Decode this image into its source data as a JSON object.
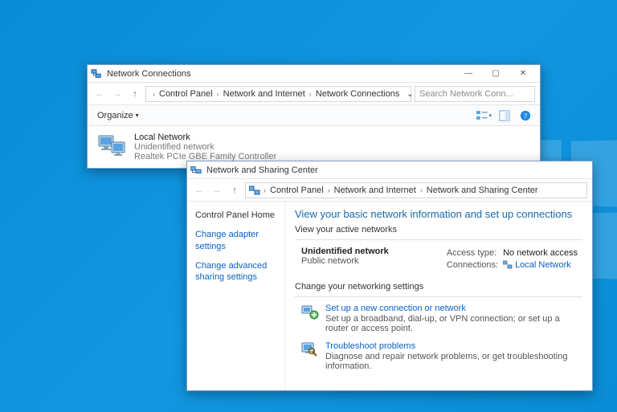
{
  "window1": {
    "title": "Network Connections",
    "breadcrumbs": [
      "Control Panel",
      "Network and Internet",
      "Network Connections"
    ],
    "search_placeholder": "Search Network Conn...",
    "toolbar": {
      "organize": "Organize"
    },
    "connection": {
      "name": "Local Network",
      "status": "Unidentified network",
      "adapter": "Realtek PCIe GBE Family Controller"
    }
  },
  "window2": {
    "title": "Network and Sharing Center",
    "breadcrumbs": [
      "Control Panel",
      "Network and Internet",
      "Network and Sharing Center"
    ],
    "sidebar": {
      "home": "Control Panel Home",
      "adapter": "Change adapter settings",
      "advanced": "Change advanced sharing settings"
    },
    "heading": "View your basic network information and set up connections",
    "active_label": "View your active networks",
    "network": {
      "name": "Unidentified network",
      "category": "Public network",
      "access_label": "Access type:",
      "access_value": "No network access",
      "conn_label": "Connections:",
      "conn_value": "Local Network"
    },
    "change_label": "Change your networking settings",
    "actions": {
      "setup_title": "Set up a new connection or network",
      "setup_desc": "Set up a broadband, dial-up, or VPN connection; or set up a router or access point.",
      "troubleshoot_title": "Troubleshoot problems",
      "troubleshoot_desc": "Diagnose and repair network problems, or get troubleshooting information."
    }
  }
}
